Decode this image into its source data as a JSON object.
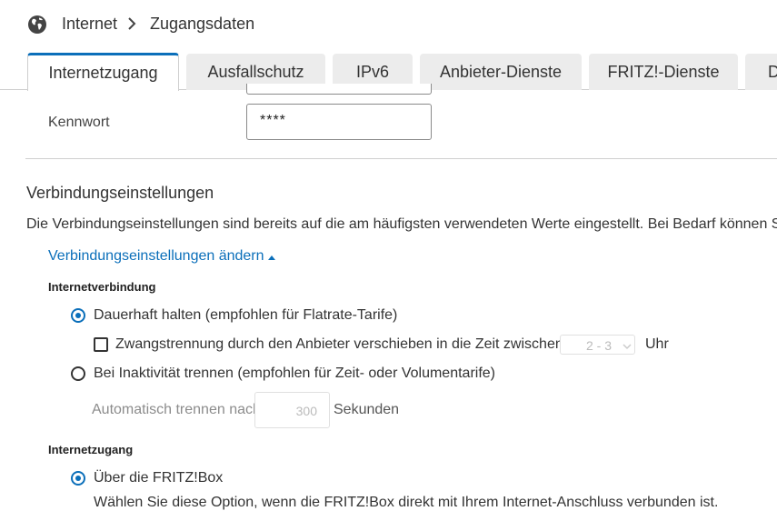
{
  "breadcrumb": {
    "icon": "globe-icon",
    "section": "Internet",
    "separator": ">",
    "page": "Zugangsdaten"
  },
  "tabs": [
    {
      "label": "Internetzugang",
      "active": true
    },
    {
      "label": "Ausfallschutz",
      "active": false
    },
    {
      "label": "IPv6",
      "active": false
    },
    {
      "label": "Anbieter-Dienste",
      "active": false
    },
    {
      "label": "FRITZ!-Dienste",
      "active": false
    },
    {
      "label": "D",
      "active": false
    }
  ],
  "password": {
    "label": "Kennwort",
    "value": "****"
  },
  "connection": {
    "title": "Verbindungseinstellungen",
    "description": "Die Verbindungseinstellungen sind bereits auf die am häufigsten verwendeten Werte eingestellt. Bei Bedarf können Sie d",
    "toggle_link": "Verbindungseinstellungen ändern",
    "toggle_icon": "caret-up-icon"
  },
  "internet_connection": {
    "heading": "Internetverbindung",
    "option_permanent": "Dauerhaft halten (empfohlen für Flatrate-Tarife)",
    "forced_disconnect_label": "Zwangstrennung durch den Anbieter verschieben in die Zeit zwischen",
    "forced_disconnect_time": "2 - 3",
    "forced_disconnect_unit": "Uhr",
    "option_inactivity": "Bei Inaktivität trennen (empfohlen für Zeit- oder Volumentarife)",
    "auto_disconnect_label": "Automatisch trennen nach",
    "auto_disconnect_value": "300",
    "auto_disconnect_unit": "Sekunden"
  },
  "internet_access": {
    "heading": "Internetzugang",
    "option_fritzbox": "Über die FRITZ!Box",
    "option_fritzbox_desc": "Wählen Sie diese Option, wenn die FRITZ!Box direkt mit Ihrem Internet-Anschluss verbunden ist."
  },
  "colors": {
    "accent": "#0b6fba",
    "tab_inactive": "#ececec",
    "divider": "#cfcfcf"
  }
}
